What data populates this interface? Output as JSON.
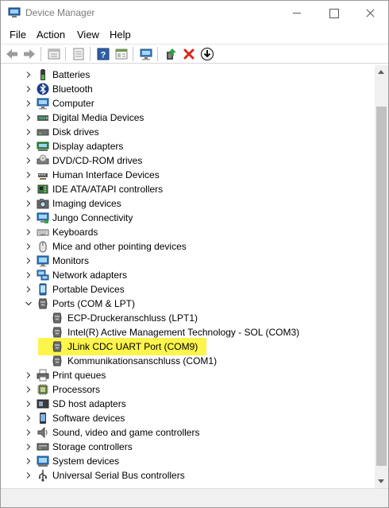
{
  "window": {
    "title": "Device Manager"
  },
  "menu": [
    "File",
    "Action",
    "View",
    "Help"
  ],
  "toolbar": [
    {
      "icon": "back-arrow-icon"
    },
    {
      "icon": "forward-arrow-icon"
    },
    {
      "icon": "properties-icon"
    },
    {
      "icon": "details-list-icon"
    },
    {
      "icon": "help-icon"
    },
    {
      "icon": "view-icon"
    },
    {
      "icon": "monitor-scan-icon"
    },
    {
      "icon": "update-driver-icon"
    },
    {
      "icon": "uninstall-icon"
    },
    {
      "icon": "download-icon"
    }
  ],
  "tree": [
    {
      "label": "Batteries",
      "icon": "battery-icon",
      "level": 0,
      "expanded": false
    },
    {
      "label": "Bluetooth",
      "icon": "bluetooth-icon",
      "level": 0,
      "expanded": false
    },
    {
      "label": "Computer",
      "icon": "computer-icon",
      "level": 0,
      "expanded": false
    },
    {
      "label": "Digital Media Devices",
      "icon": "media-device-icon",
      "level": 0,
      "expanded": false
    },
    {
      "label": "Disk drives",
      "icon": "disk-drive-icon",
      "level": 0,
      "expanded": false
    },
    {
      "label": "Display adapters",
      "icon": "display-adapter-icon",
      "level": 0,
      "expanded": false
    },
    {
      "label": "DVD/CD-ROM drives",
      "icon": "dvd-drive-icon",
      "level": 0,
      "expanded": false
    },
    {
      "label": "Human Interface Devices",
      "icon": "hid-icon",
      "level": 0,
      "expanded": false
    },
    {
      "label": "IDE ATA/ATAPI controllers",
      "icon": "ide-controller-icon",
      "level": 0,
      "expanded": false
    },
    {
      "label": "Imaging devices",
      "icon": "camera-icon",
      "level": 0,
      "expanded": false
    },
    {
      "label": "Jungo Connectivity",
      "icon": "jungo-icon",
      "level": 0,
      "expanded": false
    },
    {
      "label": "Keyboards",
      "icon": "keyboard-icon",
      "level": 0,
      "expanded": false
    },
    {
      "label": "Mice and other pointing devices",
      "icon": "mouse-icon",
      "level": 0,
      "expanded": false
    },
    {
      "label": "Monitors",
      "icon": "monitor-icon",
      "level": 0,
      "expanded": false
    },
    {
      "label": "Network adapters",
      "icon": "network-adapter-icon",
      "level": 0,
      "expanded": false
    },
    {
      "label": "Portable Devices",
      "icon": "portable-device-icon",
      "level": 0,
      "expanded": false
    },
    {
      "label": "Ports (COM & LPT)",
      "icon": "port-icon",
      "level": 0,
      "expanded": true
    },
    {
      "label": "ECP-Druckeranschluss (LPT1)",
      "icon": "port-icon",
      "level": 1
    },
    {
      "label": "Intel(R) Active Management Technology - SOL (COM3)",
      "icon": "port-icon",
      "level": 1
    },
    {
      "label": "JLink CDC UART Port (COM9)",
      "icon": "port-icon",
      "level": 1,
      "highlighted": true
    },
    {
      "label": "Kommunikationsanschluss (COM1)",
      "icon": "port-icon",
      "level": 1
    },
    {
      "label": "Print queues",
      "icon": "printer-icon",
      "level": 0,
      "expanded": false
    },
    {
      "label": "Processors",
      "icon": "processor-icon",
      "level": 0,
      "expanded": false
    },
    {
      "label": "SD host adapters",
      "icon": "sd-adapter-icon",
      "level": 0,
      "expanded": false
    },
    {
      "label": "Software devices",
      "icon": "software-device-icon",
      "level": 0,
      "expanded": false
    },
    {
      "label": "Sound, video and game controllers",
      "icon": "speaker-icon",
      "level": 0,
      "expanded": false
    },
    {
      "label": "Storage controllers",
      "icon": "storage-controller-icon",
      "level": 0,
      "expanded": false
    },
    {
      "label": "System devices",
      "icon": "system-device-icon",
      "level": 0,
      "expanded": false
    },
    {
      "label": "Universal Serial Bus controllers",
      "icon": "usb-icon",
      "level": 0,
      "expanded": false
    }
  ],
  "colors": {
    "highlight": "#fdf44c",
    "title_text": "#7a7a7a",
    "scrollbar_thumb": "#c1c1c1"
  }
}
